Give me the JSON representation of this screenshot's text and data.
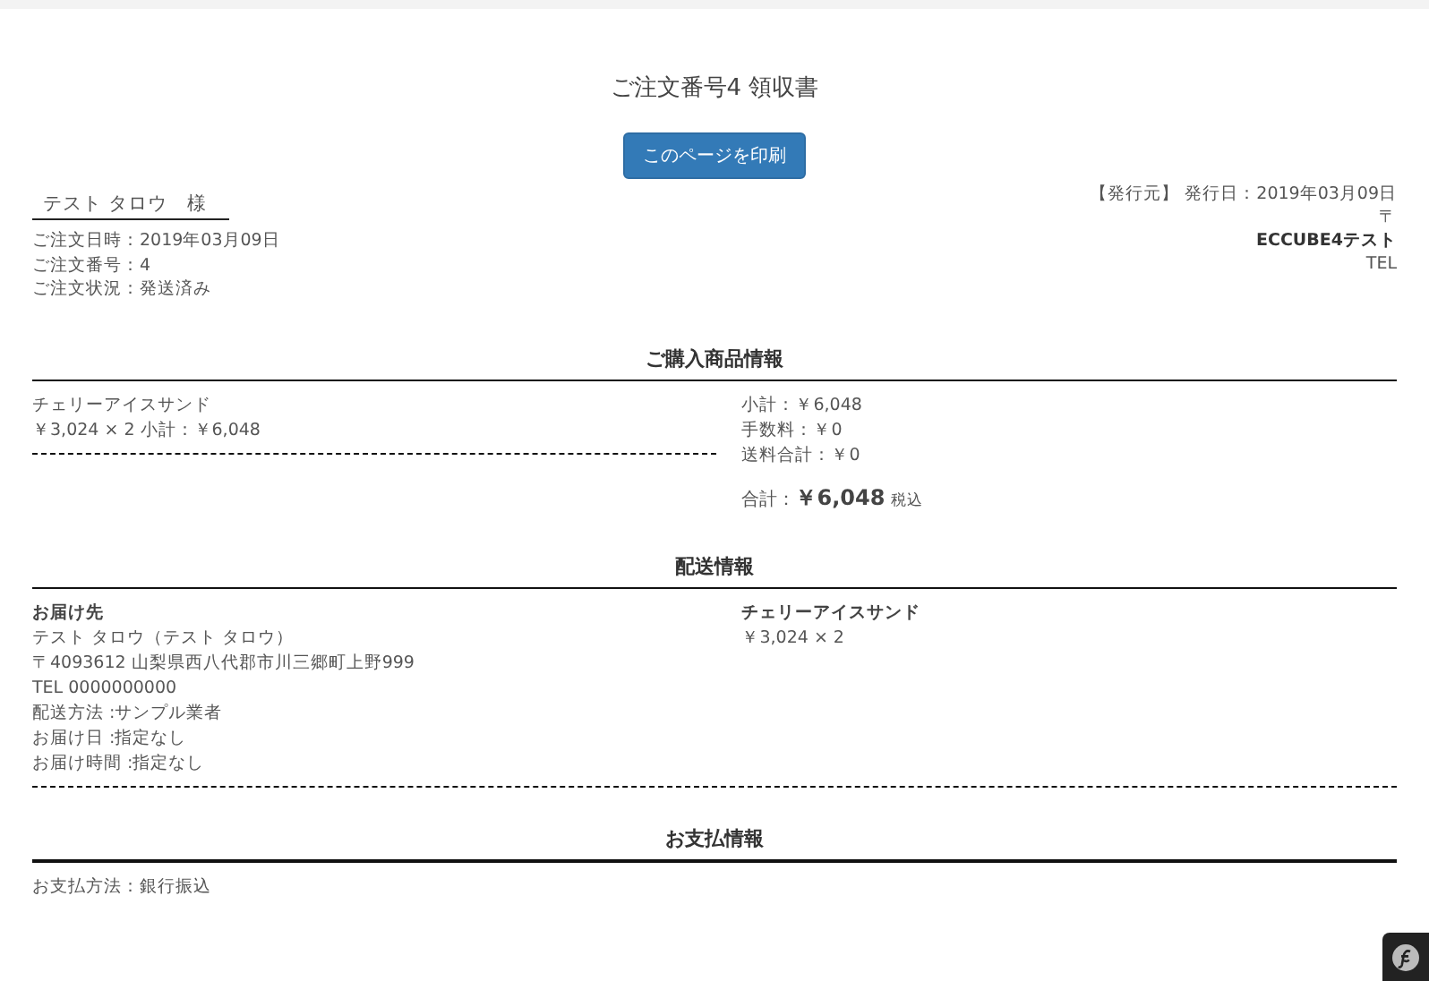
{
  "title": "ご注文番号4 領収書",
  "print_button": "このページを印刷",
  "customer": {
    "name": "テスト タロウ　様",
    "lines": [
      "ご注文日時：2019年03月09日",
      "ご注文番号：4",
      "ご注文状況：発送済み"
    ]
  },
  "issuer": {
    "issued": "【発行元】 発行日：2019年03月09日",
    "postal": "〒",
    "shop_name": "ECCUBE4テスト",
    "tel": "TEL"
  },
  "sections": [
    {
      "kind": "purchase",
      "heading": "ご購入商品情報",
      "items": [
        {
          "name": "チェリーアイスサンド",
          "detail": "￥3,024 × 2 小計：￥6,048"
        }
      ],
      "summary": [
        "小計：￥6,048",
        "手数料：￥0",
        "送料合計：￥0"
      ],
      "total": {
        "label": "合計：",
        "amount": "￥6,048",
        "note": "税込"
      }
    },
    {
      "kind": "shipping",
      "heading": "配送情報",
      "recipient_label": "お届け先",
      "lines": [
        "テスト タロウ（テスト タロウ）",
        "〒4093612 山梨県西八代郡市川三郷町上野999",
        "TEL 0000000000",
        "配送方法 :サンプル業者",
        "お届け日 :指定なし",
        "お届け時間 :指定なし"
      ],
      "items": [
        {
          "name": "チェリーアイスサンド",
          "detail": "￥3,024 × 2"
        }
      ]
    },
    {
      "kind": "payment",
      "heading": "お支払情報",
      "lines": [
        "お支払方法：銀行振込"
      ]
    }
  ]
}
